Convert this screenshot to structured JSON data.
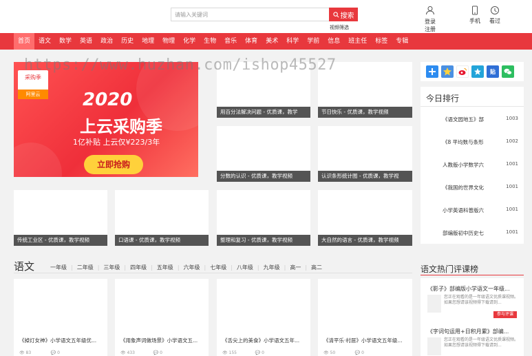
{
  "header": {
    "search_placeholder": "请输入关键词",
    "search_button": "搜索",
    "video_filter": "视频筛选",
    "login_label": "登录",
    "register_label": "注册",
    "mobile_label": "手机",
    "history_label": "看过"
  },
  "nav": {
    "items": [
      "首页",
      "语文",
      "数学",
      "英语",
      "政治",
      "历史",
      "地理",
      "物理",
      "化学",
      "生物",
      "音乐",
      "体育",
      "美术",
      "科学",
      "学前",
      "信息",
      "班主任",
      "标签",
      "专辑"
    ]
  },
  "watermark": "https://www.huzhan.com/ishop45527",
  "banner": {
    "tag": "采购季",
    "logo": "阿里云",
    "year": "2020",
    "title": "上云采购季",
    "subtitle": "1亿补贴 上云仅¥223/3年",
    "button": "立即抢购"
  },
  "featured": {
    "items": [
      "用百分法解决问题 - 优质课，教学",
      "节日快乐 - 优质课，教学视频",
      "分数的认识 - 优质课，教学视频",
      "认识条形统计图 - 优质课，教学视",
      "传统工业区 - 优质课，教学视频",
      "口语课 - 优质课，教学视频",
      "整理和复习 - 优质课，教学视频",
      "大自然的语言 - 优质课，教学视频"
    ]
  },
  "share": {
    "icons": [
      "add-icon",
      "star-icon",
      "weibo-icon",
      "qzone-icon",
      "tieba-icon",
      "wechat-icon"
    ],
    "colors": [
      "#2d8cf0",
      "#4a90e2",
      "#e6162d",
      "#23a4d9",
      "#2f6fd6",
      "#2dbe60"
    ]
  },
  "ranking": {
    "title": "今日排行",
    "items": [
      {
        "name": "《语文园地五》部",
        "count": "1003"
      },
      {
        "name": "《8 平均数与条形",
        "count": "1002"
      },
      {
        "name": "人教版小学数学六",
        "count": "1001"
      },
      {
        "name": "《我国的世界文化",
        "count": "1001"
      },
      {
        "name": "小学英语科普版六",
        "count": "1001"
      },
      {
        "name": "部编版初中历史七",
        "count": "1001"
      }
    ]
  },
  "section": {
    "title": "语文",
    "grades": [
      "一年级",
      "二年级",
      "三年级",
      "四年级",
      "五年级",
      "六年级",
      "七年级",
      "八年级",
      "九年级",
      "高一",
      "高二"
    ]
  },
  "hot": {
    "title": "语文热门评课榜",
    "items": [
      {
        "name": "《影子》部编版小学语文一年级...",
        "desc": "您正在观看的是一年级语文优质课视频。如果您想请该视频得下载请到...",
        "badge": "参与评课"
      },
      {
        "name": "《字词句运用+日积月累》部编...",
        "desc": "您正在观看的是一年级语文优质课视频。如果您想请该视频得下载请到..."
      }
    ]
  },
  "courses": {
    "items": [
      {
        "title": "《掉灯女神》小学语文五年级优...",
        "views": "83",
        "comments": "0"
      },
      {
        "title": "《用象声词做场景》小学语文五...",
        "views": "433",
        "comments": "0"
      },
      {
        "title": "《舌尖上的美食》小学语文五年...",
        "views": "155",
        "comments": "0"
      },
      {
        "title": "《清平乐·村居》小学语文五年级...",
        "views": "50",
        "comments": "0"
      }
    ]
  }
}
